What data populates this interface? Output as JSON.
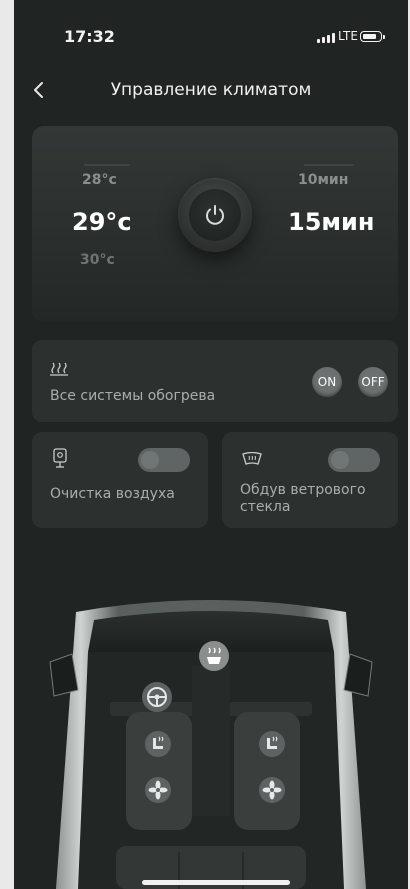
{
  "status_bar": {
    "time": "17:32",
    "network": "LTE"
  },
  "header": {
    "title": "Управление климатом"
  },
  "climate": {
    "temp_above": "28°с",
    "temp_current": "29°с",
    "temp_below": "30°с",
    "time_above": "10мин",
    "time_current": "15мин"
  },
  "heating": {
    "label": "Все системы обогрева",
    "on_label": "ON",
    "off_label": "OFF"
  },
  "air_purify": {
    "label": "Очистка воздуха",
    "enabled": false
  },
  "windshield": {
    "label_line1": "Обдув ветрового",
    "label_line2": "стекла",
    "enabled": false
  },
  "colors": {
    "background": "#202524",
    "card": "#2c3130",
    "accent": "#ffffff"
  }
}
